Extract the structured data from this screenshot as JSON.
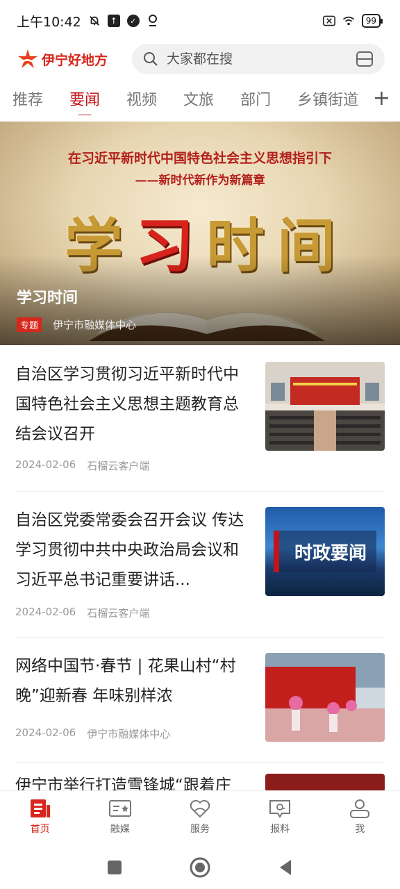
{
  "status_bar": {
    "time": "上午10:42",
    "battery": "99"
  },
  "header": {
    "logo_text": "伊宁好地方",
    "search_placeholder": "大家都在搜"
  },
  "tabs": [
    {
      "label": "推荐",
      "active": false
    },
    {
      "label": "要闻",
      "active": true
    },
    {
      "label": "视频",
      "active": false
    },
    {
      "label": "文旅",
      "active": false
    },
    {
      "label": "部门",
      "active": false
    },
    {
      "label": "乡镇街道",
      "active": false
    }
  ],
  "banner": {
    "line1": "在习近平新时代中国特色社会主义思想指引下",
    "line2": "——新时代新作为新篇章",
    "big_chars": [
      "学",
      "习",
      "时",
      "间"
    ],
    "title": "学习时间",
    "badge": "专题",
    "source": "伊宁市融媒体中心"
  },
  "news": [
    {
      "title": "自治区学习贯彻习近平新时代中国特色社会主义思想主题教育总结会议召开",
      "date": "2024-02-06",
      "source": "石榴云客户端",
      "thumb": "meeting-hall"
    },
    {
      "title": "自治区党委常委会召开会议 传达学习贯彻中共中央政治局会议和习近平总书记重要讲话...",
      "date": "2024-02-06",
      "source": "石榴云客户端",
      "thumb": "politics-news",
      "thumb_text": "时政要闻"
    },
    {
      "title": "网络中国节·春节 | 花果山村“村晚”迎新春 年味别样浓",
      "date": "2024-02-06",
      "source": "伊宁市融媒体中心",
      "thumb": "village-performance"
    },
    {
      "title": "伊宁市举行打造雪锋城“跟着庄",
      "thumb": "partial"
    }
  ],
  "bottom_nav": [
    {
      "label": "首页",
      "icon": "home-icon",
      "active": true
    },
    {
      "label": "融媒",
      "icon": "media-icon",
      "active": false
    },
    {
      "label": "服务",
      "icon": "heart-hands-icon",
      "active": false
    },
    {
      "label": "报料",
      "icon": "report-icon",
      "active": false
    },
    {
      "label": "我",
      "icon": "user-icon",
      "active": false
    }
  ],
  "colors": {
    "accent": "#d7261b",
    "tab_active": "#c2181f"
  }
}
